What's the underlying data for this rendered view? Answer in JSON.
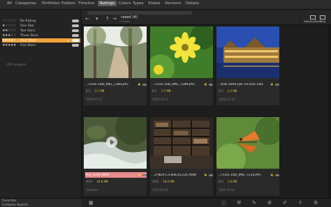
{
  "tabs": [
    "All",
    "Categories",
    "Portfolios",
    "Folders",
    "Timeline",
    "Ratings",
    "Colors",
    "Types",
    "States",
    "Versions",
    "Details"
  ],
  "active_tab": "Ratings",
  "ratings": [
    {
      "stars": 0,
      "label": "No Rating",
      "count": "",
      "selected": false
    },
    {
      "stars": 1,
      "label": "One Star",
      "count": "",
      "selected": false
    },
    {
      "stars": 2,
      "label": "Two Stars",
      "count": "",
      "selected": false
    },
    {
      "stars": 3,
      "label": "Three Stars",
      "count": "",
      "selected": false
    },
    {
      "stars": 4,
      "label": "Four Stars",
      "count": "",
      "selected": true,
      "mark": "×"
    },
    {
      "stars": 5,
      "label": "Five Stars",
      "count": "",
      "selected": false
    }
  ],
  "left_hint": "(0/6 images)",
  "left_bottom": {
    "row1": "Favorites",
    "row2": "Complex Search"
  },
  "toolbar": {
    "path": "rated (4)",
    "path_sub": "4 items",
    "btn1": "Edit/Info/Rules",
    "btn2": "View"
  },
  "cards": [
    {
      "name": "...l EOS 10D_IMG_7383.JPG",
      "type": "JPG",
      "size": "3.7 MB",
      "date": "2005-10-15",
      "warn": false,
      "thumb": "path"
    },
    {
      "name": "...l EOS 10D_IMG_7289.JPG",
      "type": "JPG",
      "size": "1.7 MB",
      "date": "2005-10-02",
      "warn": false,
      "thumb": "flower"
    },
    {
      "name": "...656 2004-JUL-19 EOS 10D",
      "type": "JPG",
      "size": "2.2 MB",
      "date": "2004-12-18",
      "warn": false,
      "thumb": "castle"
    },
    {
      "name": "MVI_1305.MOV",
      "type": "MOV",
      "size": "18.8 MB",
      "date": "Samples",
      "warn": true,
      "thumb": "waterfall"
    },
    {
      "name": "...2-NEX-C3-DSC01235.ARW",
      "type": "ARW",
      "size": "16.0 MB",
      "date": "2015-02-02",
      "warn": false,
      "thumb": "library"
    },
    {
      "name": "...l EOS 10D_IMG_7214.JPG",
      "type": "JPG",
      "size": "1.6 MB",
      "date": "2005-10-02",
      "warn": false,
      "thumb": "butterfly"
    }
  ],
  "colors": {
    "accent": "#f1a23a",
    "star": "#f0c419",
    "warn": "#e88b8b"
  }
}
